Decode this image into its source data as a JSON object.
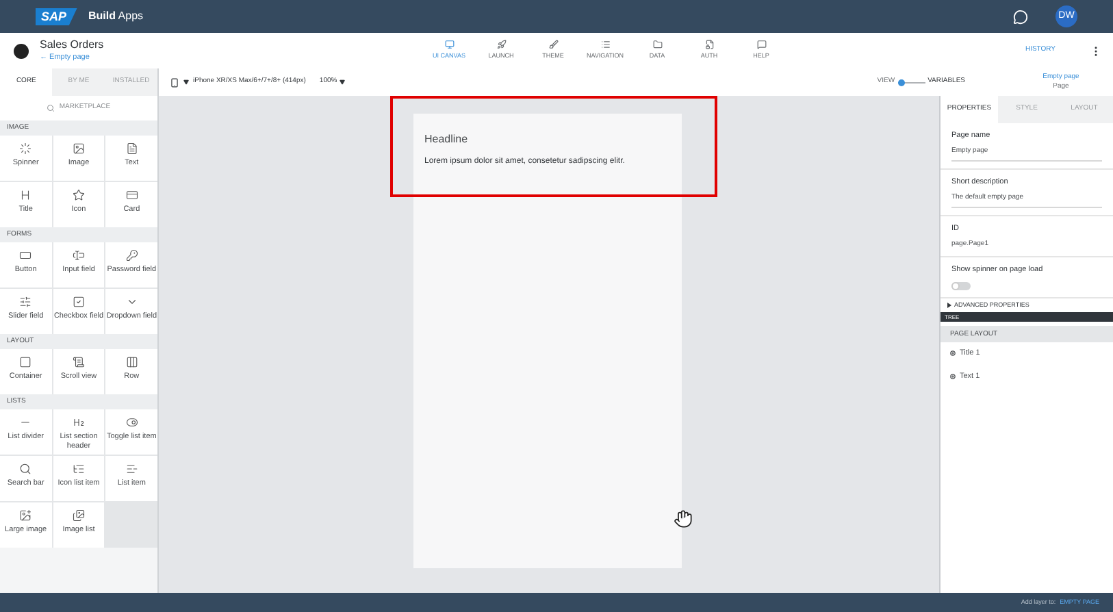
{
  "topbar": {
    "logo": "SAP",
    "product": "Build",
    "product_suffix": "Apps",
    "avatar": "DW"
  },
  "project": {
    "title": "Sales Orders",
    "breadcrumb": "← Empty page"
  },
  "nav": [
    {
      "label": "UI CANVAS",
      "selected": true
    },
    {
      "label": "LAUNCH",
      "selected": false
    },
    {
      "label": "THEME",
      "selected": false
    },
    {
      "label": "NAVIGATION",
      "selected": false
    },
    {
      "label": "DATA",
      "selected": false
    },
    {
      "label": "AUTH",
      "selected": false
    },
    {
      "label": "HELP",
      "selected": false
    }
  ],
  "history": "HISTORY",
  "library": {
    "tabs": [
      {
        "label": "CORE",
        "selected": true
      },
      {
        "label": "BY ME",
        "selected": false
      },
      {
        "label": "INSTALLED",
        "selected": false
      }
    ],
    "search_placeholder": "MARKETPLACE",
    "sections": [
      {
        "title": "IMAGE",
        "items": [
          {
            "label": "Spinner"
          },
          {
            "label": "Image"
          },
          {
            "label": "Text"
          },
          {
            "label": "Title"
          },
          {
            "label": "Icon"
          },
          {
            "label": "Card"
          }
        ]
      },
      {
        "title": "FORMS",
        "items": [
          {
            "label": "Button"
          },
          {
            "label": "Input field"
          },
          {
            "label": "Password field"
          },
          {
            "label": "Slider field"
          },
          {
            "label": "Checkbox field"
          },
          {
            "label": "Dropdown field"
          }
        ]
      },
      {
        "title": "LAYOUT",
        "items": [
          {
            "label": "Container"
          },
          {
            "label": "Scroll view"
          },
          {
            "label": "Row"
          }
        ]
      },
      {
        "title": "LISTS",
        "items": [
          {
            "label": "List divider"
          },
          {
            "label": "List section header"
          },
          {
            "label": "Toggle list item"
          },
          {
            "label": "Search bar"
          },
          {
            "label": "Icon list item"
          },
          {
            "label": "List item"
          },
          {
            "label": "Large image"
          },
          {
            "label": "Image list"
          }
        ]
      }
    ]
  },
  "device": {
    "label": "iPhone XR/XS Max/6+/7+/8+ (414px)",
    "zoom": "100%"
  },
  "view_toggle": {
    "left": "VIEW",
    "right": "VARIABLES",
    "on": false
  },
  "selection": {
    "name": "Empty page",
    "type": "Page"
  },
  "canvas": {
    "headline": "Headline",
    "body": "Lorem ipsum dolor sit amet, consetetur sadipscing elitr.",
    "highlighted": true
  },
  "properties": {
    "tabs": [
      {
        "label": "PROPERTIES",
        "selected": true
      },
      {
        "label": "STYLE",
        "selected": false
      },
      {
        "label": "LAYOUT",
        "selected": false
      }
    ],
    "fields": [
      {
        "kind": "input",
        "label": "Page name",
        "value": "Empty page"
      },
      {
        "kind": "input",
        "label": "Short description",
        "value": "The default empty page"
      },
      {
        "kind": "text",
        "label": "ID",
        "value": "page.Page1"
      },
      {
        "kind": "switch",
        "label": "Show spinner on page load",
        "on": false
      }
    ],
    "advanced": "ADVANCED PROPERTIES",
    "tree": "TREE",
    "page_layout": "PAGE LAYOUT",
    "tree_items": [
      {
        "label": "Title 1"
      },
      {
        "label": "Text 1"
      }
    ]
  },
  "footer": {
    "label": "Add layer to:",
    "target": "EMPTY PAGE"
  }
}
